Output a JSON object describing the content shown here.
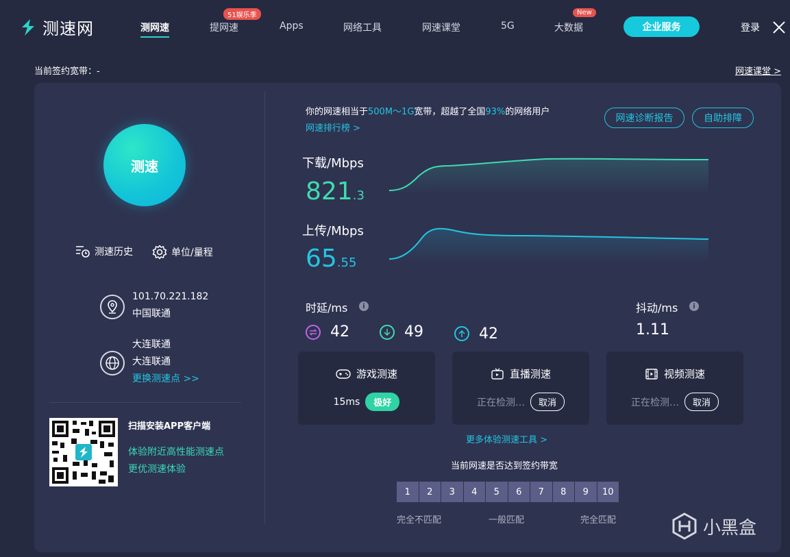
{
  "header": {
    "logo_text": "测速网",
    "nav": [
      {
        "label": "测网速",
        "active": true
      },
      {
        "label": "提网速",
        "badge": "51娱乐季"
      },
      {
        "label": "Apps"
      },
      {
        "label": "网络工具"
      },
      {
        "label": "网速课堂"
      },
      {
        "label": "5G"
      },
      {
        "label": "大数据",
        "badge": "New"
      }
    ],
    "enterprise_label": "企业服务",
    "login_label": "登录"
  },
  "top_bar": {
    "bandwidth_label": "当前签约宽带：-",
    "course_link": "网速课堂 >"
  },
  "left": {
    "start_label": "测速",
    "history_label": "测速历史",
    "unit_label": "单位/量程",
    "ip": "101.70.221.182",
    "isp": "中国联通",
    "server_line1": "大连联通",
    "server_line2": "大连联通",
    "switch_label": "更换测速点 >>",
    "app_title": "扫描安装APP客户端",
    "app_line1": "体验附近高性能测速点",
    "app_line2": "更优测速体验"
  },
  "summary": {
    "prefix": "你的网速相当于",
    "range": "500M～1G",
    "mid": "宽带，超越了全国",
    "percent": "93%",
    "suffix": "的网络用户",
    "rank_link": "网速排行榜 >",
    "report_btn": "网速诊断报告",
    "self_btn": "自助排障"
  },
  "download": {
    "label": "下载/Mbps",
    "int": "821",
    "dec": ".3",
    "color": "#3fdcb0"
  },
  "upload": {
    "label": "上传/Mbps",
    "int": "65",
    "dec": ".55",
    "color": "#23c6e0"
  },
  "latency": {
    "label": "时延/ms",
    "idle": "42",
    "down": "49",
    "up": "42",
    "idle_color": "#c264e6",
    "down_color": "#3fdcb0",
    "up_color": "#23c6e0"
  },
  "jitter": {
    "label": "抖动/ms",
    "value": "1.11"
  },
  "subtests": {
    "game": {
      "title": "游戏测速",
      "value": "15ms",
      "grade": "极好"
    },
    "live": {
      "title": "直播测速",
      "status": "正在检测…",
      "cancel": "取消"
    },
    "video": {
      "title": "视频测速",
      "status": "正在检测…",
      "cancel": "取消"
    },
    "more_link": "更多体验测速工具 >"
  },
  "match": {
    "title": "当前网速是否达到签约带宽",
    "scale": [
      "1",
      "2",
      "3",
      "4",
      "5",
      "6",
      "7",
      "8",
      "9",
      "10"
    ],
    "low": "完全不匹配",
    "mid": "一般匹配",
    "high": "完全匹配"
  },
  "watermark": "小黑盒"
}
